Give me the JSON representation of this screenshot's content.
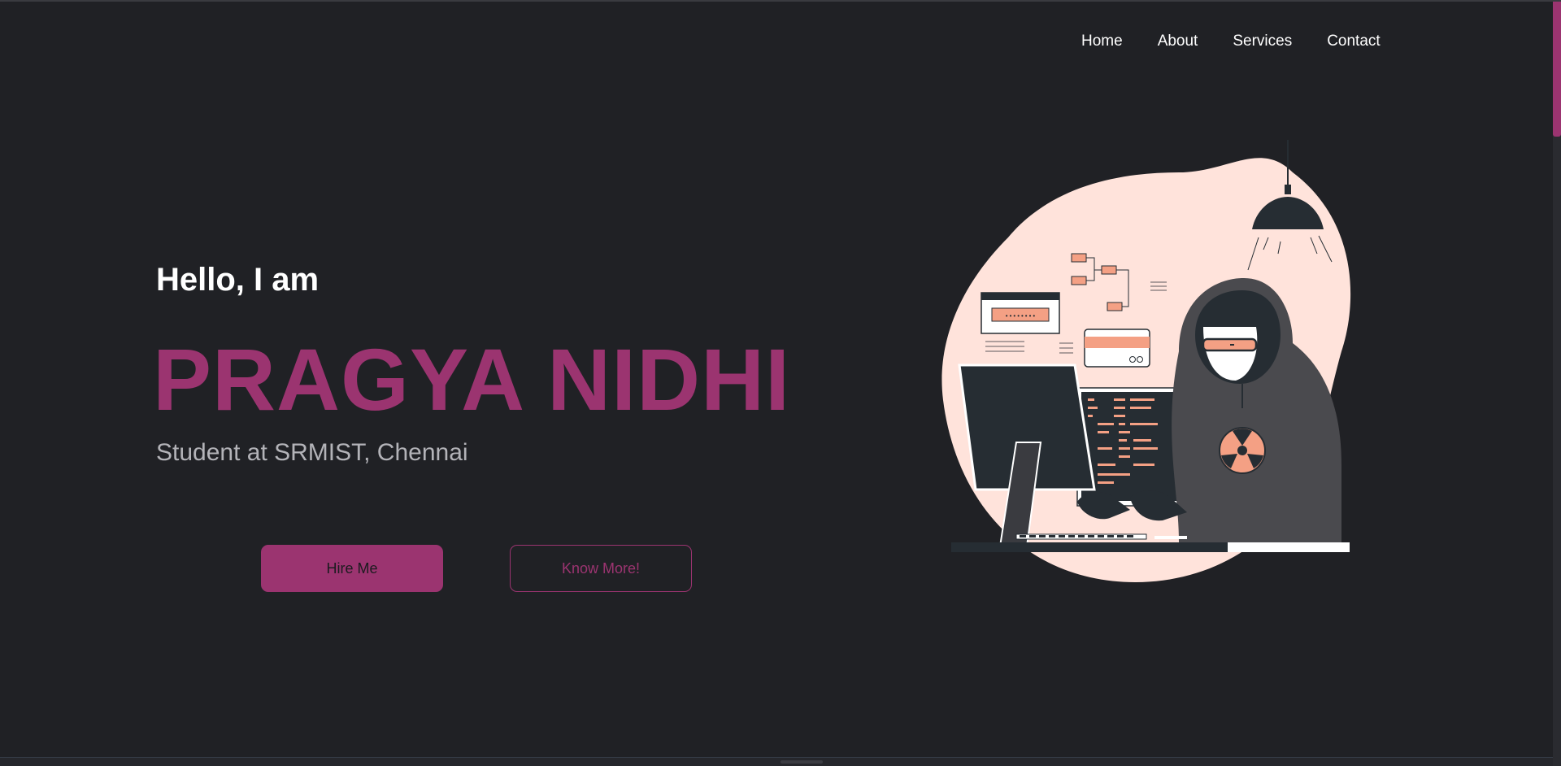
{
  "nav": {
    "items": [
      {
        "label": "Home"
      },
      {
        "label": "About"
      },
      {
        "label": "Services"
      },
      {
        "label": "Contact"
      }
    ]
  },
  "hero": {
    "greeting": "Hello, I am",
    "name": "PRAGYA NIDHI",
    "subtitle": "Student at SRMIST, Chennai",
    "hire_label": "Hire Me",
    "know_label": "Know More!"
  },
  "colors": {
    "background": "#202125",
    "accent": "#9b3470",
    "blob": "#ffe3db",
    "highlight": "#f4a084",
    "dark": "#262d33"
  },
  "illustration": {
    "icon": "hacker-at-computer-illustration"
  }
}
